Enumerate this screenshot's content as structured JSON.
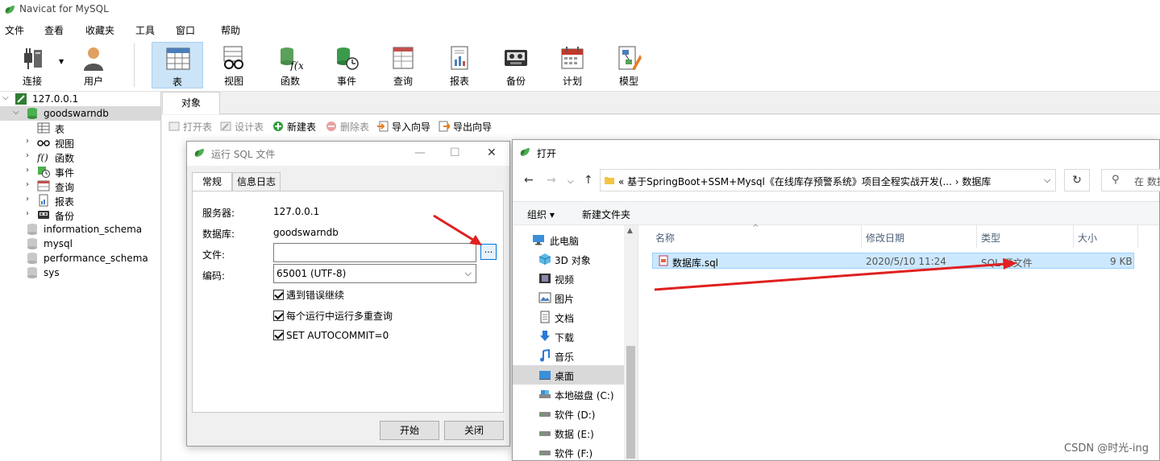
{
  "app": {
    "title": "Navicat for MySQL"
  },
  "menu": [
    "文件",
    "查看",
    "收藏夹",
    "工具",
    "窗口",
    "帮助"
  ],
  "toolbar": {
    "buttons": [
      {
        "label": "连接",
        "icon": "connection-icon"
      },
      {
        "label": "用户",
        "icon": "user-icon"
      },
      {
        "label": "表",
        "icon": "table-icon",
        "active": true
      },
      {
        "label": "视图",
        "icon": "view-icon"
      },
      {
        "label": "函数",
        "icon": "function-icon"
      },
      {
        "label": "事件",
        "icon": "event-icon"
      },
      {
        "label": "查询",
        "icon": "query-icon"
      },
      {
        "label": "报表",
        "icon": "report-icon"
      },
      {
        "label": "备份",
        "icon": "backup-icon"
      },
      {
        "label": "计划",
        "icon": "schedule-icon"
      },
      {
        "label": "模型",
        "icon": "model-icon"
      }
    ]
  },
  "tree": {
    "connection": "127.0.0.1",
    "database": "goodswarndb",
    "children": [
      "表",
      "视图",
      "函数",
      "事件",
      "查询",
      "报表",
      "备份"
    ],
    "other_dbs": [
      "information_schema",
      "mysql",
      "performance_schema",
      "sys"
    ]
  },
  "object_tab": "对象",
  "object_toolbar": {
    "open": "打开表",
    "design": "设计表",
    "new": "新建表",
    "delete": "删除表",
    "import": "导入向导",
    "export": "导出向导"
  },
  "run_sql_dialog": {
    "title": "运行 SQL 文件",
    "tabs": [
      "常规",
      "信息日志"
    ],
    "server_label": "服务器:",
    "server_value": "127.0.0.1",
    "db_label": "数据库:",
    "db_value": "goodswarndb",
    "file_label": "文件:",
    "file_value": "",
    "browse": "...",
    "encoding_label": "编码:",
    "encoding_value": "65001 (UTF-8)",
    "options": [
      "遇到错误继续",
      "每个运行中运行多重查询",
      "SET AUTOCOMMIT=0"
    ],
    "start_button": "开始",
    "close_button": "关闭"
  },
  "open_dialog": {
    "title": "打开",
    "address": "«  基于SpringBoot+SSM+Mysql《在线库存预警系统》项目全程实战开发(...  ›  数据库",
    "search_placeholder": "在 数据",
    "organize": "组织 ▾",
    "new_folder": "新建文件夹",
    "nav": [
      "此电脑",
      "3D 对象",
      "视频",
      "图片",
      "文档",
      "下载",
      "音乐",
      "桌面",
      "本地磁盘 (C:)",
      "软件 (D:)",
      "数据 (E:)",
      "软件 (F:)"
    ],
    "columns": [
      "名称",
      "修改日期",
      "类型",
      "大小"
    ],
    "file": {
      "name": "数据库.sql",
      "date": "2020/5/10 11:24",
      "type": "SQL 源文件",
      "size": "9 KB"
    }
  },
  "watermark": "CSDN @时光-ing",
  "colors": {
    "accent": "#0078d7",
    "arrow": "#e02020",
    "selected": "#cce8ff"
  }
}
